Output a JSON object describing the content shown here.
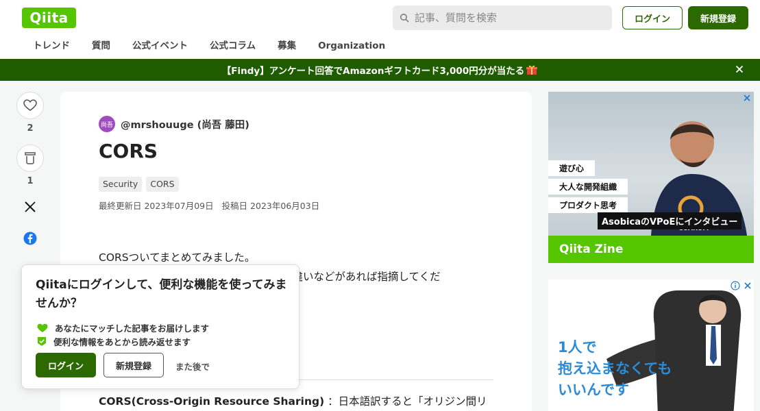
{
  "header": {
    "logo": "Qiita",
    "search_placeholder": "記事、質問を検索",
    "login": "ログイン",
    "signup": "新規登録"
  },
  "nav": {
    "items": [
      "トレンド",
      "質問",
      "公式イベント",
      "公式コラム",
      "募集",
      "Organization"
    ]
  },
  "banner": {
    "text": "【Findy】アンケート回答でAmazonギフトカード3,000円分が当たる"
  },
  "rail": {
    "like_count": "2",
    "stock_count": "1"
  },
  "article": {
    "avatar_text": "尚吾",
    "author": "@mrshouuge (尚吾 藤田)",
    "title": "CORS",
    "tags": [
      "Security",
      "CORS"
    ],
    "updated_label": "最終更新日 2023年07月09日",
    "posted_label": "投稿日 2023年06月03日",
    "body_line1": "CORSついてまとめてみました。",
    "body_line2": "ので間違いなどがあれば指摘してくだ",
    "body_line3_bold": "CORS(Cross-Origin Resource Sharing)",
    "body_line3_rest": "：日本語訳すると「オリジン間リ"
  },
  "ad1": {
    "tags": [
      "遊び心",
      "大人な開発組織",
      "プロダクト思考"
    ],
    "caption": "AsobicaのVPoEにインタビュー",
    "brand": "Qiita Zine"
  },
  "ad2": {
    "lines": [
      "1人で",
      "抱え込まなくても",
      "いいんです"
    ]
  },
  "popup": {
    "title": "Qiitaにログインして、便利な機能を使ってみませんか？",
    "benefit1": "あなたにマッチした記事をお届けします",
    "benefit2": "便利な情報をあとから読み返せます",
    "login": "ログイン",
    "signup": "新規登録",
    "later": "また後で"
  },
  "colors": {
    "brand_green": "#55c500",
    "dark_green": "#2c6900",
    "banner_green": "#1f5c00"
  }
}
